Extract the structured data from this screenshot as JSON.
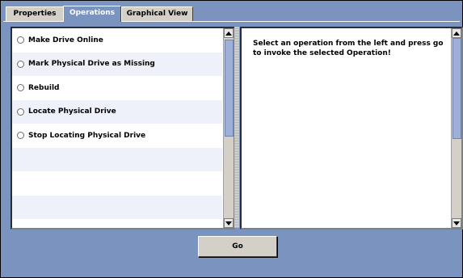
{
  "tabs": [
    {
      "label": "Properties",
      "active": false
    },
    {
      "label": "Operations",
      "active": true
    },
    {
      "label": "Graphical View",
      "active": false
    }
  ],
  "operations": [
    {
      "label": "Make Drive Online"
    },
    {
      "label": "Mark Physical Drive as Missing"
    },
    {
      "label": "Rebuild"
    },
    {
      "label": "Locate Physical Drive"
    },
    {
      "label": "Stop Locating Physical Drive"
    }
  ],
  "instructions": "Select an operation from the left and press go to invoke the selected Operation!",
  "go_button_label": "Go",
  "colors": {
    "background": "#7b93bf",
    "tab_inactive": "#d4d0c8",
    "row_alt": "#eef1fa",
    "scroll_thumb": "#9fb0d8"
  }
}
